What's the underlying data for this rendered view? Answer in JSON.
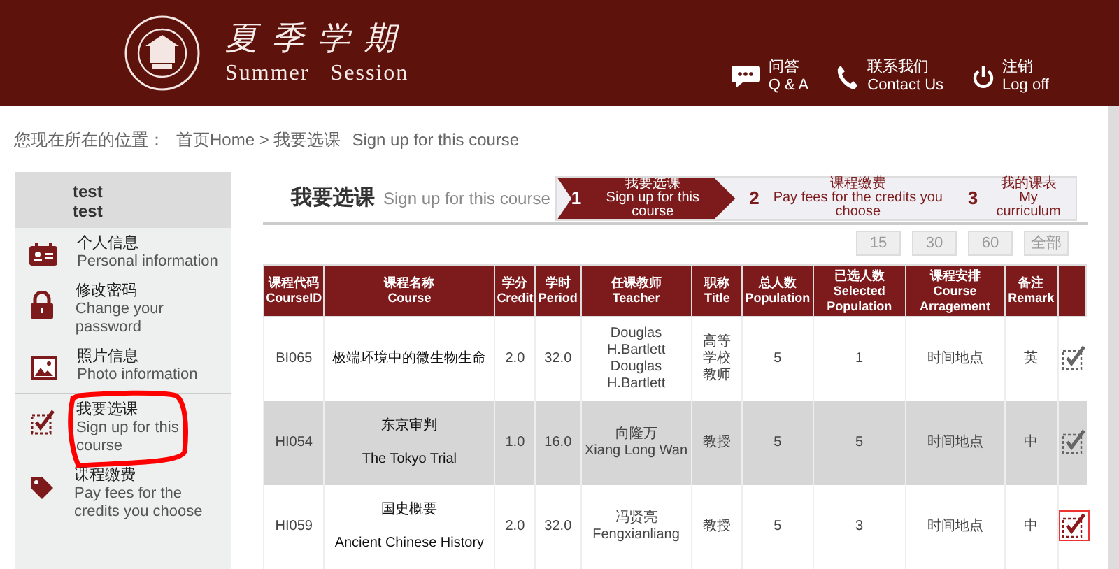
{
  "header": {
    "logo_title": "夏季学期",
    "logo_subtitle": "Summer   Session",
    "links": [
      {
        "kind": "chat",
        "zh": "问答",
        "en": "Q & A"
      },
      {
        "kind": "phone",
        "zh": "联系我们",
        "en": "Contact Us"
      },
      {
        "kind": "power",
        "zh": "注销",
        "en": "Log off"
      }
    ]
  },
  "breadcrumb": {
    "label": "您现在所在的位置：",
    "path": "首页Home > 我要选课",
    "current": "Sign up for this course"
  },
  "sidebar": {
    "user": {
      "line1": "test",
      "line2": "test"
    },
    "items": [
      {
        "kind": "id",
        "zh": "个人信息",
        "en": "Personal information",
        "selected": false
      },
      {
        "kind": "lock",
        "zh": "修改密码",
        "en": "Change your password",
        "selected": false
      },
      {
        "kind": "photo",
        "zh": "照片信息",
        "en": "Photo information",
        "selected": false
      },
      {
        "kind": "check",
        "zh": "我要选课",
        "en": "Sign up for this course",
        "selected": true
      },
      {
        "kind": "tag",
        "zh": "课程缴费",
        "en": "Pay fees for the credits you choose",
        "selected": false
      }
    ]
  },
  "main": {
    "title": "我要选课",
    "subtitle": "Sign up for this course",
    "steps": [
      {
        "number": "1",
        "zh": "我要选课",
        "en": "Sign up for this course",
        "selected": true
      },
      {
        "number": "2",
        "zh": "课程缴费",
        "en": "Pay fees for the credits you choose",
        "selected": false
      },
      {
        "number": "3",
        "zh": "我的课表",
        "en": "My curriculum",
        "selected": false
      }
    ],
    "page_sizes": [
      "15",
      "30",
      "60",
      "全部"
    ],
    "table": {
      "columns": [
        {
          "zh": "课程代码",
          "en": "CourseID"
        },
        {
          "zh": "课程名称",
          "en": "Course"
        },
        {
          "zh": "学分",
          "en": "Credit"
        },
        {
          "zh": "学时",
          "en": "Period"
        },
        {
          "zh": "任课教师",
          "en": "Teacher"
        },
        {
          "zh": "职称",
          "en": "Title"
        },
        {
          "zh": "总人数",
          "en": "Population"
        },
        {
          "zh": "已选人数",
          "en": "Selected Population"
        },
        {
          "zh": "课程安排",
          "en": "Course Arragement"
        },
        {
          "zh": "备注",
          "en": "Remark"
        }
      ],
      "rows": [
        {
          "id": "BI065",
          "course": [
            "极端环境中的微生物生命"
          ],
          "credit": "2.0",
          "period": "32.0",
          "teacher": [
            "Douglas H.Bartlett",
            "Douglas H.Bartlett"
          ],
          "title": "高等学校教师",
          "population": "5",
          "selected_population": "1",
          "arrangement": "时间地点",
          "remark": "英",
          "selected": false
        },
        {
          "id": "HI054",
          "course": [
            "东京审判",
            "The Tokyo Trial"
          ],
          "credit": "1.0",
          "period": "16.0",
          "teacher": [
            "向隆万",
            "Xiang Long Wan"
          ],
          "title": "教授",
          "population": "5",
          "selected_population": "5",
          "arrangement": "时间地点",
          "remark": "中",
          "selected": false
        },
        {
          "id": "HI059",
          "course": [
            "国史概要",
            "Ancient Chinese History"
          ],
          "credit": "2.0",
          "period": "32.0",
          "teacher": [
            "冯贤亮",
            "Fengxianliang"
          ],
          "title": "教授",
          "population": "5",
          "selected_population": "3",
          "arrangement": "时间地点",
          "remark": "中",
          "selected": true
        }
      ]
    }
  }
}
